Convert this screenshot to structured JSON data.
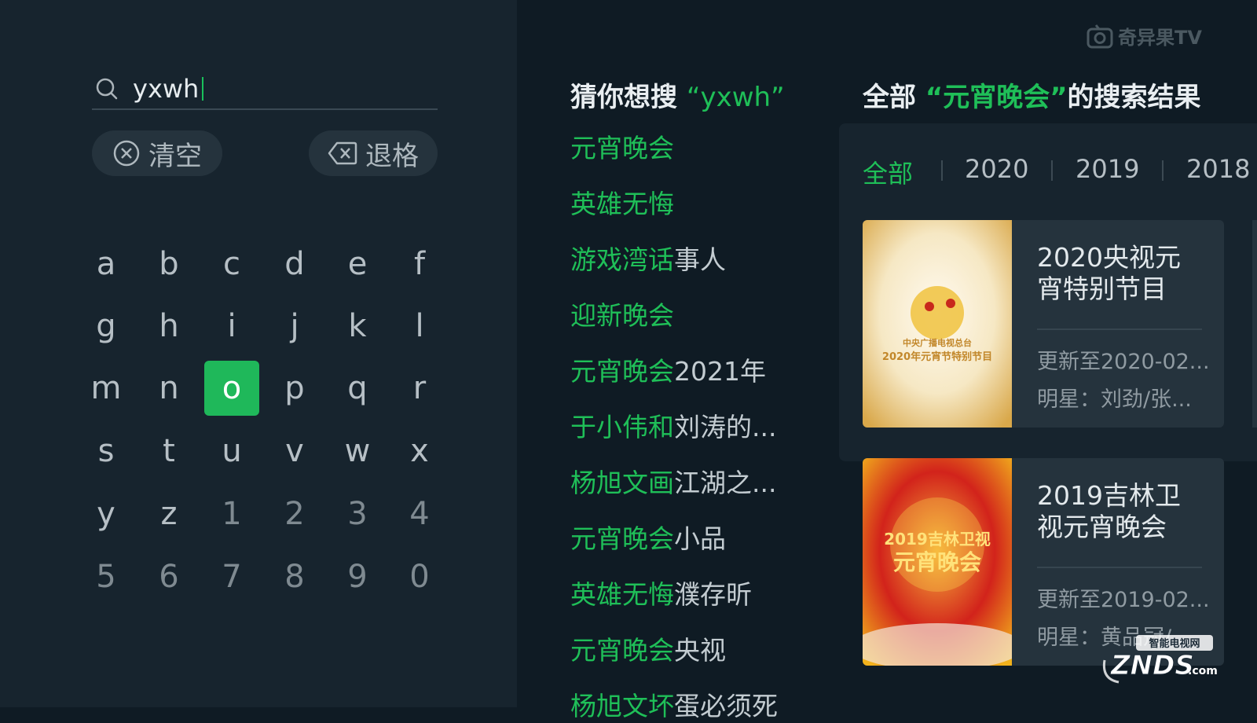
{
  "brand": {
    "logo_text": "奇异果TV"
  },
  "search": {
    "query": "yxwh"
  },
  "actions": {
    "clear_label": "清空",
    "backspace_label": "退格"
  },
  "keyboard": {
    "focused_key": "o",
    "rows": [
      [
        "a",
        "b",
        "c",
        "d",
        "e",
        "f"
      ],
      [
        "g",
        "h",
        "i",
        "j",
        "k",
        "l"
      ],
      [
        "m",
        "n",
        "o",
        "p",
        "q",
        "r"
      ],
      [
        "s",
        "t",
        "u",
        "v",
        "w",
        "x"
      ],
      [
        "y",
        "z",
        "1",
        "2",
        "3",
        "4"
      ],
      [
        "5",
        "6",
        "7",
        "8",
        "9",
        "0"
      ]
    ]
  },
  "suggestions": {
    "title_prefix": "猜你想搜",
    "title_query": "“yxwh”",
    "items": [
      {
        "hl": "元宵晚会",
        "rest": ""
      },
      {
        "hl": "英雄无悔",
        "rest": ""
      },
      {
        "hl": "游戏湾话",
        "rest": "事人"
      },
      {
        "hl": "迎新晚会",
        "rest": ""
      },
      {
        "hl": "元宵晚会",
        "rest": "2021年"
      },
      {
        "hl": "于小伟和",
        "rest": "刘涛的..."
      },
      {
        "hl": "杨旭文画",
        "rest": "江湖之..."
      },
      {
        "hl": "元宵晚会",
        "rest": "小品"
      },
      {
        "hl": "英雄无悔",
        "rest": "濮存昕"
      },
      {
        "hl": "元宵晚会",
        "rest": "央视"
      },
      {
        "hl": "杨旭文坏",
        "rest": "蛋必须死"
      }
    ]
  },
  "results": {
    "title_prefix": "全部",
    "title_query": "“元宵晚会”",
    "title_suffix": "的搜索结果",
    "tabs": [
      "全部",
      "2020",
      "2019",
      "2018"
    ],
    "active_tab": "全部",
    "cards": [
      {
        "title": "2020央视元宵特别节目",
        "update": "更新至2020-02...",
        "star": "明星：刘劲/张...",
        "poster_text": "中央广播电视总台",
        "poster_subtext": "2020年元宵节特别节目",
        "poster_colors": [
          "#f6e8c4",
          "#d9a84a"
        ]
      },
      {
        "title": "2019吉林卫视元宵晚会",
        "update": "更新至2019-02...",
        "star": "明星：黄品冠/...",
        "poster_text": "2019吉林卫视",
        "poster_subtext": "元宵晚会",
        "poster_colors": [
          "#d2231b",
          "#f2b21c"
        ]
      }
    ]
  },
  "watermark": {
    "text": "ZNDS",
    "suffix": ".com",
    "tag": "智能电视网"
  },
  "colors": {
    "accent": "#1fbf58",
    "background": "#0f1b24",
    "panel": "#17242e",
    "card": "#25333d"
  }
}
